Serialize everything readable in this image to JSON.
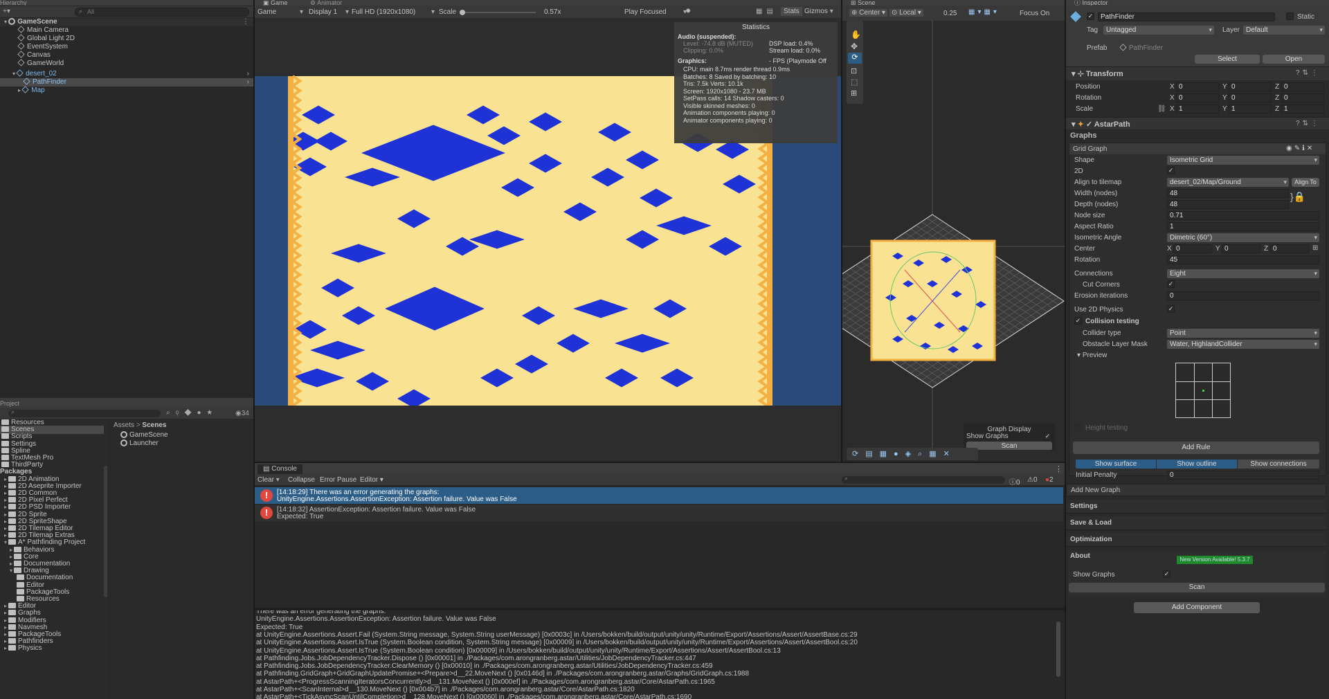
{
  "hierarchy": {
    "tab": "Hierarchy",
    "search_placeholder": "All",
    "scene": "GameScene",
    "items": [
      "Main Camera",
      "Global Light 2D",
      "EventSystem",
      "Canvas",
      "GameWorld"
    ],
    "prefab": "desert_02",
    "children": [
      "PathFinder",
      "Map"
    ]
  },
  "game": {
    "tab": "Game",
    "tab2": "Animator",
    "mode": "Game",
    "display": "Display 1",
    "resolution": "Full HD (1920x1080)",
    "scale_label": "Scale",
    "scale_value": "0.57x",
    "play_mode": "Play Focused",
    "stats_btn": "Stats",
    "gizmos_btn": "Gizmos"
  },
  "stats": {
    "title": "Statistics",
    "audio_head": "Audio (suspended):",
    "level": "Level: -74.8 dB (MUTED)",
    "clipping": "Clipping: 0.0%",
    "dsp": "DSP load: 0.4%",
    "stream": "Stream load: 0.0%",
    "graphics_head": "Graphics:",
    "fps": "- FPS (Playmode Off",
    "lines": [
      "CPU: main 8.7ms  render thread 0.9ms",
      "Batches: 8     Saved by batching: 10",
      "Tris: 7.5k   Verts: 10.1k",
      "Screen: 1920x1080 - 23.7 MB",
      "SetPass calls: 14      Shadow casters: 0",
      "Visible skinned meshes: 0",
      "Animation components playing: 0",
      "Animator components playing: 0"
    ]
  },
  "scene": {
    "tab": "Scene",
    "pivot": "Center",
    "space": "Local",
    "snap": "0.25",
    "focus": "Focus On",
    "graph_display_title": "Graph Display",
    "show_graphs": "Show Graphs",
    "scan": "Scan"
  },
  "project": {
    "tab": "Project",
    "count": "34",
    "breadcrumb_root": "Assets",
    "breadcrumb_leaf": "Scenes",
    "tree": [
      "Resources",
      "Scenes",
      "Scripts",
      "Settings",
      "Spline",
      "TextMesh Pro",
      "ThirdParty"
    ],
    "packages_head": "Packages",
    "packages": [
      "2D Animation",
      "2D Aseprite Importer",
      "2D Common",
      "2D Pixel Perfect",
      "2D PSD Importer",
      "2D Sprite",
      "2D SpriteShape",
      "2D Tilemap Editor",
      "2D Tilemap Extras",
      "A* Pathfinding Project"
    ],
    "astar_children": [
      "Behaviors",
      "Core",
      "Documentation",
      "Drawing"
    ],
    "drawing_children": [
      "Documentation",
      "Editor",
      "PackageTools",
      "Resources"
    ],
    "astar_rest": [
      "Editor",
      "Graphs",
      "Modifiers",
      "Navmesh",
      "PackageTools",
      "Pathfinders",
      "Physics"
    ],
    "files": [
      "GameScene",
      "Launcher"
    ]
  },
  "console": {
    "tab": "Console",
    "clear": "Clear",
    "collapse": "Collapse",
    "error_pause": "Error Pause",
    "editor": "Editor",
    "count_log": "0",
    "count_warn": "0",
    "count_err": "2",
    "entries": [
      {
        "line1": "[14:18:29] There was an error generating the graphs:",
        "line2": "UnityEngine.Assertions.AssertionException: Assertion failure. Value was False"
      },
      {
        "line1": "[14:18:32] AssertionException: Assertion failure. Value was False",
        "line2": "Expected: True"
      }
    ],
    "detail": [
      "There was an error generating the graphs:",
      "UnityEngine.Assertions.AssertionException: Assertion failure. Value was False",
      "Expected: True",
      "  at UnityEngine.Assertions.Assert.Fail (System.String message, System.String userMessage) [0x0003c] in /Users/bokken/build/output/unity/unity/Runtime/Export/Assertions/Assert/AssertBase.cs:29",
      "  at UnityEngine.Assertions.Assert.IsTrue (System.Boolean condition, System.String message) [0x00009] in /Users/bokken/build/output/unity/unity/Runtime/Export/Assertions/Assert/AssertBool.cs:20",
      "  at UnityEngine.Assertions.Assert.IsTrue (System.Boolean condition) [0x00009] in /Users/bokken/build/output/unity/unity/Runtime/Export/Assertions/Assert/AssertBool.cs:13",
      "  at Pathfinding.Jobs.JobDependencyTracker.Dispose () [0x00001] in ./Packages/com.arongranberg.astar/Utilities/JobDependencyTracker.cs:447",
      "  at Pathfinding.Jobs.JobDependencyTracker.ClearMemory () [0x00010] in ./Packages/com.arongranberg.astar/Utilities/JobDependencyTracker.cs:459",
      "  at Pathfinding.GridGraph+GridGraphUpdatePromise+<Prepare>d__22.MoveNext () [0x0146d] in ./Packages/com.arongranberg.astar/Graphs/GridGraph.cs:1988",
      "  at AstarPath+<ProgressScanningIteratorsConcurrently>d__131.MoveNext () [0x000ef] in ./Packages/com.arongranberg.astar/Core/AstarPath.cs:1965",
      "  at AstarPath+<ScanInternal>d__130.MoveNext () [0x004b7] in ./Packages/com.arongranberg.astar/Core/AstarPath.cs:1820",
      "  at AstarPath+<TickAsyncScanUntilCompletion>d__128.MoveNext () [0x00060] in ./Packages/com.arongranberg.astar/Core/AstarPath.cs:1690"
    ]
  },
  "inspector": {
    "tab": "Inspector",
    "name": "PathFinder",
    "static": "Static",
    "tag_label": "Tag",
    "tag": "Untagged",
    "layer_label": "Layer",
    "layer": "Default",
    "prefab_label": "Prefab",
    "prefab": "PathFinder",
    "select": "Select",
    "open": "Open",
    "transform": "Transform",
    "position_label": "Position",
    "rotation_label": "Rotation",
    "scale_label": "Scale",
    "pos": [
      "0",
      "0",
      "0"
    ],
    "rot": [
      "0",
      "0",
      "0"
    ],
    "scl": [
      "1",
      "1",
      "1"
    ],
    "component": "AstarPath",
    "graphs_head": "Graphs",
    "grid_graph": "Grid Graph",
    "fields": {
      "shape_label": "Shape",
      "shape": "Isometric Grid",
      "twod_label": "2D",
      "align_label": "Align to tilemap",
      "align": "desert_02/Map/Ground",
      "align_btn": "Align To",
      "width_label": "Width (nodes)",
      "width": "48",
      "depth_label": "Depth (nodes)",
      "depth": "48",
      "node_size_label": "Node size",
      "node_size": "0.71",
      "aspect_label": "Aspect Ratio",
      "aspect": "1",
      "iso_label": "Isometric Angle",
      "iso": "Dimetric (60°)",
      "center_label": "Center",
      "center": [
        "0",
        "0",
        "0"
      ],
      "rotation_label": "Rotation",
      "rotation": "45",
      "connections_label": "Connections",
      "connections": "Eight",
      "cut_label": "Cut Corners",
      "erosion_label": "Erosion iterations",
      "erosion": "0",
      "physics_label": "Use 2D Physics",
      "collision_label": "Collision testing",
      "collider_label": "Collider type",
      "collider": "Point",
      "mask_label": "Obstacle Layer Mask",
      "mask": "Water, HighlandCollider",
      "preview_label": "Preview",
      "height_label": "Height testing",
      "add_rule": "Add Rule",
      "show_surface": "Show surface",
      "show_outline": "Show outline",
      "show_connections": "Show connections",
      "penalty_label": "Initial Penalty",
      "penalty": "0"
    },
    "add_new_graph": "Add New Graph",
    "sections": [
      "Settings",
      "Save & Load",
      "Optimization"
    ],
    "about": "About",
    "new_version": "New Version Available! 5.3.7",
    "show_graphs": "Show Graphs",
    "scan": "Scan",
    "add_component": "Add Component"
  },
  "colors": {
    "water": "#1f32d6",
    "sand": "#f9e392",
    "edge": "#f5b043",
    "bg_blue": "#2a4a7a",
    "accent": "#2c5d87"
  }
}
